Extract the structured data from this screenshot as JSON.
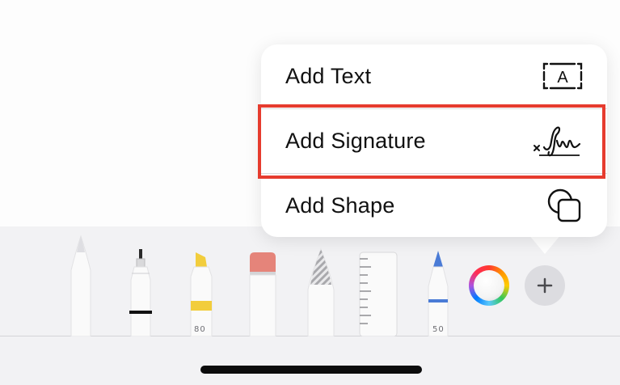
{
  "menu": {
    "items": [
      {
        "label": "Add Text",
        "icon": "text-box-icon"
      },
      {
        "label": "Add Signature",
        "icon": "signature-icon"
      },
      {
        "label": "Add Shape",
        "icon": "shapes-icon"
      }
    ],
    "highlighted_item": "Add Signature",
    "highlight_color": "#e63b2e"
  },
  "toolbar": {
    "tools": [
      {
        "name": "pen",
        "icon": "pen-icon"
      },
      {
        "name": "fineliner",
        "icon": "fineliner-icon",
        "color": "#111111"
      },
      {
        "name": "highlighter",
        "icon": "highlighter-icon",
        "color": "#f2cd3c",
        "size": "80"
      },
      {
        "name": "eraser",
        "icon": "eraser-icon",
        "color": "#e5847a"
      },
      {
        "name": "lasso",
        "icon": "lasso-icon"
      },
      {
        "name": "ruler",
        "icon": "ruler-icon"
      },
      {
        "name": "pencil",
        "icon": "pencil-icon",
        "color": "#4a7bd6",
        "size": "50"
      }
    ],
    "color_picker": {
      "icon": "color-wheel-icon"
    },
    "add_button": {
      "icon": "plus-icon"
    }
  }
}
